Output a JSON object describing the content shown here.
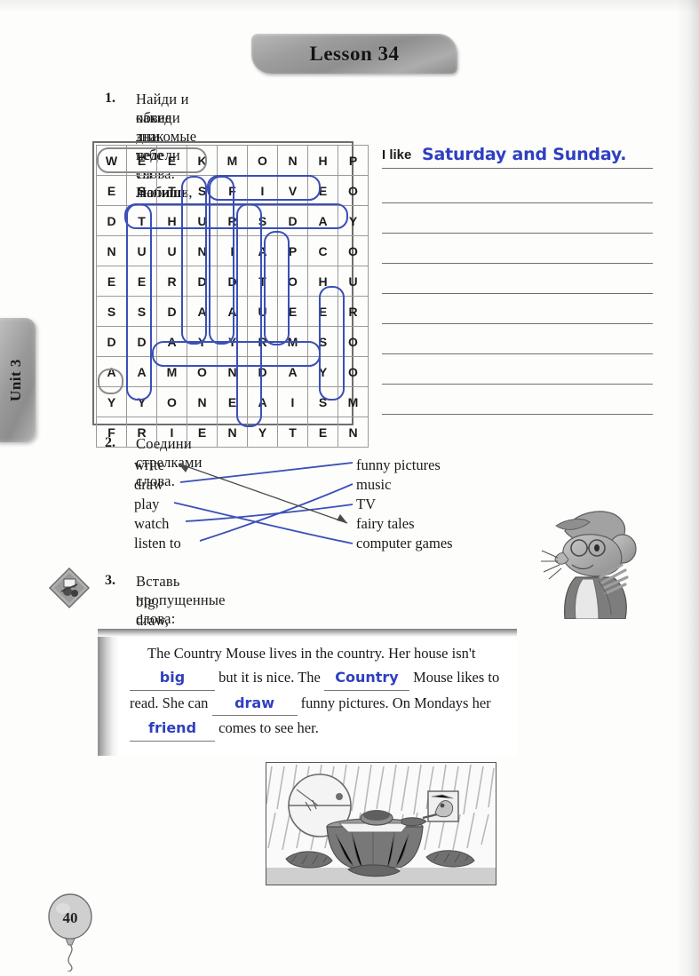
{
  "page": {
    "number": "40",
    "unit_tab": "Unit 3",
    "lesson_title": "Lesson 34"
  },
  "exercise1": {
    "number": "1.",
    "instruction_line1": "Найди и обведи знакомые тебе слова. Напиши,",
    "instruction_line2": "какие дни недели ты любишь.",
    "answer_prompt": "I like",
    "answer_handwritten": "Saturday and Sunday.",
    "blank_line_count": 8,
    "grid": {
      "rows": 10,
      "cols": 9,
      "letters": [
        [
          "W",
          "E",
          "E",
          "K",
          "M",
          "O",
          "N",
          "H",
          "P"
        ],
        [
          "E",
          "S",
          "T",
          "S",
          "F",
          "I",
          "V",
          "E",
          "O"
        ],
        [
          "D",
          "T",
          "H",
          "U",
          "R",
          "S",
          "D",
          "A",
          "Y"
        ],
        [
          "N",
          "U",
          "U",
          "N",
          "I",
          "A",
          "P",
          "C",
          "O"
        ],
        [
          "E",
          "E",
          "R",
          "D",
          "D",
          "T",
          "O",
          "H",
          "U"
        ],
        [
          "S",
          "S",
          "D",
          "A",
          "A",
          "U",
          "E",
          "E",
          "R"
        ],
        [
          "D",
          "D",
          "A",
          "Y",
          "Y",
          "R",
          "M",
          "S",
          "O"
        ],
        [
          "A",
          "A",
          "M",
          "O",
          "N",
          "D",
          "A",
          "Y",
          "O"
        ],
        [
          "Y",
          "Y",
          "O",
          "N",
          "E",
          "A",
          "I",
          "S",
          "M"
        ],
        [
          "F",
          "R",
          "I",
          "E",
          "N",
          "Y",
          "T",
          "E",
          "N"
        ]
      ],
      "circled_words": [
        "WEEK",
        "FIVE",
        "THURSDAY",
        "MONDAY",
        "SUNDAY",
        "TUESDAY",
        "SATURDAY",
        "FRIDAY",
        "ROOM"
      ]
    }
  },
  "exercise2": {
    "number": "2.",
    "instruction": "Соедини стрелками слова.",
    "left_items": [
      "write",
      "draw",
      "play",
      "watch",
      "listen to"
    ],
    "right_items": [
      "funny pictures",
      "music",
      "TV",
      "fairy tales",
      "computer games"
    ],
    "matches": [
      {
        "from": "draw",
        "to": "funny pictures"
      },
      {
        "from": "listen to",
        "to": "music"
      },
      {
        "from": "watch",
        "to": "TV"
      },
      {
        "from": "write",
        "to": "fairy tales"
      },
      {
        "from": "play",
        "to": "computer games"
      }
    ]
  },
  "exercise3": {
    "number": "3.",
    "instruction_line1": "Вставь пропущенные слова:",
    "instruction_line2": "big, draw, friend, Country.",
    "word_bank": [
      "big",
      "draw",
      "friend",
      "Country"
    ],
    "text_parts": {
      "p1": "The Country Mouse lives in the country. Her house isn't ",
      "blank1": "big",
      "p2": " but it is nice. The ",
      "blank2": "Country",
      "p3": " Mouse likes to read. She can ",
      "blank3": "draw",
      "p4": " funny pictures. On Mondays her ",
      "blank4": "friend",
      "p5": " comes to see her."
    },
    "illustration_caption": ""
  },
  "colors": {
    "handwriting_blue": "#2f3fc0",
    "pencil_blue": "#3a4fb8",
    "rule_gray": "#6f6f6f",
    "banner_gray": "#9d9d9d",
    "text_black": "#1a1a1a"
  },
  "icons": {
    "craft": "craft-diamond-icon",
    "mouse": "mouse-character-illustration",
    "scene": "stump-table-scene-illustration",
    "balloon": "balloon-page-number"
  }
}
